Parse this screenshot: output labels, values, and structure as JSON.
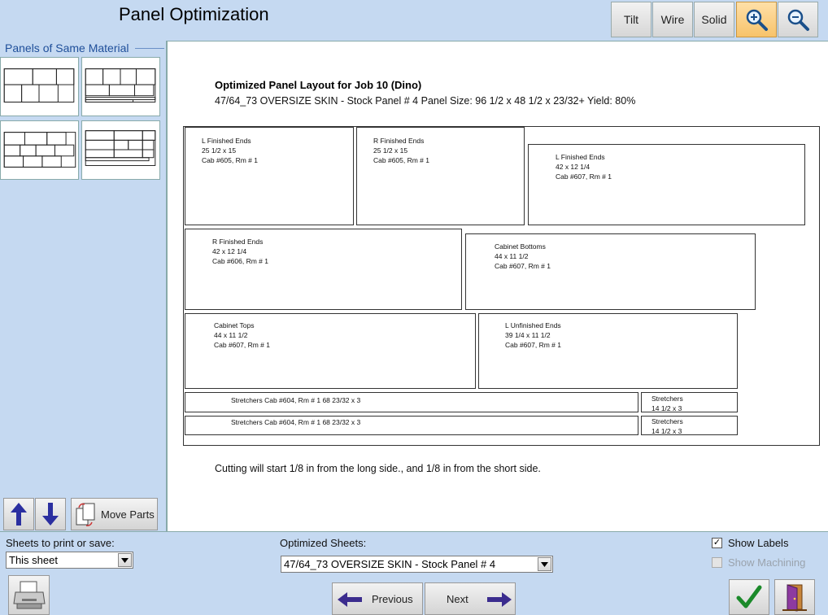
{
  "app": {
    "title": "Panel Optimization"
  },
  "toolbar": {
    "tilt_label": "Tilt",
    "wire_label": "Wire",
    "solid_label": "Solid",
    "zoom_in_icon": "zoom-in-icon",
    "zoom_out_icon": "zoom-out-icon",
    "active_color": "#f7c36b"
  },
  "sidebar": {
    "header": "Panels of Same Material",
    "move_parts_label": "Move Parts"
  },
  "layout": {
    "title": "Optimized Panel Layout for Job 10 (Dino)",
    "subtitle": "47/64_73 OVERSIZE SKIN - Stock Panel  # 4 Panel Size: 96 1/2 x 48 1/2 x 23/32+ Yield: 80%",
    "cut_note": "Cutting will start 1/8 in from the long side., and 1/8 in from the short side.",
    "parts": [
      {
        "name": "L Finished Ends",
        "size": "25 1/2 x 15",
        "cab": "Cab #605, Rm # 1"
      },
      {
        "name": "R Finished Ends",
        "size": "25 1/2 x 15",
        "cab": "Cab #605, Rm # 1"
      },
      {
        "name": "L Finished Ends",
        "size": "42 x 12 1/4",
        "cab": "Cab #607, Rm # 1"
      },
      {
        "name": "R Finished Ends",
        "size": "42 x 12 1/4",
        "cab": "Cab #606, Rm # 1"
      },
      {
        "name": "Cabinet Bottoms",
        "size": "44 x 11 1/2",
        "cab": "Cab #607, Rm # 1"
      },
      {
        "name": "Cabinet Tops",
        "size": "44 x 11 1/2",
        "cab": "Cab #607, Rm # 1"
      },
      {
        "name": "L Unfinished Ends",
        "size": "39 1/4 x 11 1/2",
        "cab": "Cab #607, Rm # 1"
      },
      {
        "name": "Stretchers Cab #604, Rm # 1  68 23/32 x 3"
      },
      {
        "name": "Stretchers",
        "size": "14 1/2 x 3"
      },
      {
        "name": "Stretchers Cab #604, Rm # 1  68 23/32 x 3"
      },
      {
        "name": "Stretchers",
        "size": "14 1/2 x 3"
      }
    ]
  },
  "bottom": {
    "sheets_label": "Sheets to print or save:",
    "sheets_value": "This sheet",
    "optimized_label": "Optimized Sheets:",
    "optimized_value": "47/64_73 OVERSIZE SKIN - Stock Panel  # 4",
    "previous_label": "Previous",
    "next_label": "Next",
    "show_labels": "Show Labels",
    "show_labels_checked": true,
    "show_machining": "Show Machining",
    "show_machining_checked": false
  }
}
